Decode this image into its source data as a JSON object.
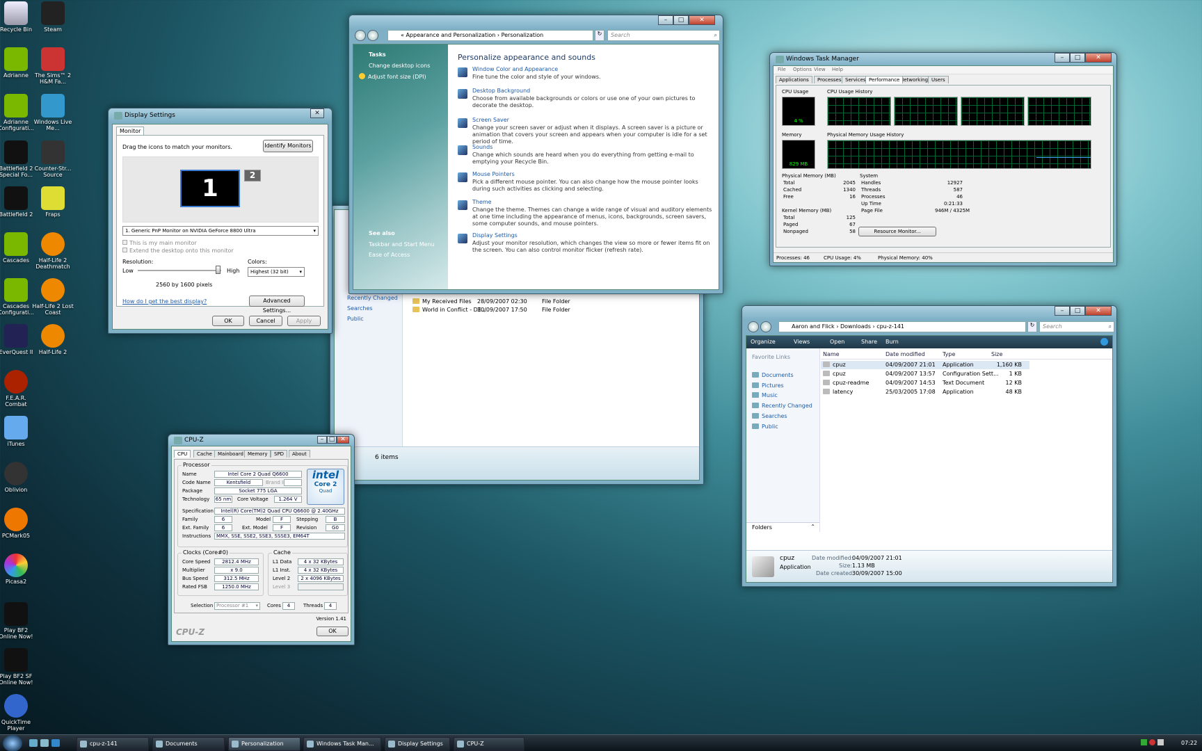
{
  "desktop": {
    "icons": [
      "Recycle Bin",
      "Steam",
      "Adrianne",
      "The Sims™ 2 H&M Fa...",
      "Adrianne Configurati...",
      "Windows Live Me...",
      "Battlefield 2 Special Fo...",
      "Counter-Str... Source",
      "Battlefield 2",
      "Fraps",
      "Cascades",
      "Half-Life 2 Deathmatch",
      "Cascades Configurati...",
      "Half-Life 2 Lost Coast",
      "EverQuest II",
      "Half-Life 2",
      "F.E.A.R. Combat",
      "iTunes",
      "Oblivion",
      "PCMark05",
      "Picasa2",
      "Play BF2 Online Now!",
      "Play BF2 SF Online Now!",
      "QuickTime Player"
    ]
  },
  "display_settings": {
    "title": "Display Settings",
    "tab": "Monitor",
    "instruction": "Drag the icons to match your monitors.",
    "identify_button": "Identify Monitors",
    "monitor1": "1",
    "monitor2": "2",
    "monitor_select": "1. Generic PnP Monitor on NVIDIA GeForce 8800 Ultra",
    "main_monitor": "This is my main monitor",
    "extend": "Extend the desktop onto this monitor",
    "resolution_label": "Resolution:",
    "low": "Low",
    "high": "High",
    "resolution_value": "2560 by 1600 pixels",
    "colors_label": "Colors:",
    "colors_value": "Highest (32 bit)",
    "help_link": "How do I get the best display?",
    "advanced_button": "Advanced Settings...",
    "ok": "OK",
    "cancel": "Cancel",
    "apply": "Apply"
  },
  "personalization": {
    "breadcrumb": [
      "«",
      "Appearance and Personalization",
      "›",
      "Personalization"
    ],
    "search_placeholder": "Search",
    "tasks_title": "Tasks",
    "tasks": [
      "Change desktop icons",
      "Adjust font size (DPI)"
    ],
    "see_also_title": "See also",
    "see_also": [
      "Taskbar and Start Menu",
      "Ease of Access"
    ],
    "heading": "Personalize appearance and sounds",
    "items": [
      {
        "title": "Window Color and Appearance",
        "desc": "Fine tune the color and style of your windows."
      },
      {
        "title": "Desktop Background",
        "desc": "Choose from available backgrounds or colors or use one of your own pictures to decorate the desktop."
      },
      {
        "title": "Screen Saver",
        "desc": "Change your screen saver or adjust when it displays. A screen saver is a picture or animation that covers your screen and appears when your computer is idle for a set period of time."
      },
      {
        "title": "Sounds",
        "desc": "Change which sounds are heard when you do everything from getting e-mail to emptying your Recycle Bin."
      },
      {
        "title": "Mouse Pointers",
        "desc": "Pick a different mouse pointer. You can also change how the mouse pointer looks during such activities as clicking and selecting."
      },
      {
        "title": "Theme",
        "desc": "Change the theme. Themes can change a wide range of visual and auditory elements at one time including the appearance of menus, icons, backgrounds, screen savers, some computer sounds, and mouse pointers."
      },
      {
        "title": "Display Settings",
        "desc": "Adjust your monitor resolution, which changes the view so more or fewer items fit on the screen. You can also control monitor flicker (refresh rate)."
      }
    ]
  },
  "documents": {
    "nav": [
      "Recently Changed",
      "Searches",
      "Public"
    ],
    "files": [
      {
        "name": "My Received Files",
        "date": "28/09/2007 02:30",
        "type": "File Folder"
      },
      {
        "name": "World in Conflict - DE...",
        "date": "30/09/2007 17:50",
        "type": "File Folder"
      }
    ],
    "status": "6 items",
    "fav_partial": "Favo"
  },
  "taskmgr": {
    "title": "Windows Task Manager",
    "menu": [
      "File",
      "Options",
      "View",
      "Help"
    ],
    "tabs": [
      "Applications",
      "Processes",
      "Services",
      "Performance",
      "Networking",
      "Users"
    ],
    "cpu_usage_label": "CPU Usage",
    "cpu_value": "4 %",
    "cpu_history_label": "CPU Usage History",
    "memory_label": "Memory",
    "memory_value": "829 MB",
    "mem_history_label": "Physical Memory Usage History",
    "phys_title": "Physical Memory (MB)",
    "phys": [
      [
        "Total",
        "2045"
      ],
      [
        "Cached",
        "1340"
      ],
      [
        "Free",
        "16"
      ]
    ],
    "kernel_title": "Kernel Memory (MB)",
    "kernel": [
      [
        "Total",
        "125"
      ],
      [
        "Paged",
        "67"
      ],
      [
        "Nonpaged",
        "58"
      ]
    ],
    "system_title": "System",
    "system": [
      [
        "Handles",
        "12927"
      ],
      [
        "Threads",
        "587"
      ],
      [
        "Processes",
        "46"
      ],
      [
        "Up Time",
        "0:21:33"
      ],
      [
        "Page File",
        "946M / 4325M"
      ]
    ],
    "resource_button": "Resource Monitor...",
    "status": [
      "Processes: 46",
      "CPU Usage: 4%",
      "Physical Memory: 40%"
    ]
  },
  "explorer": {
    "breadcrumb": [
      "Aaron and Flick",
      "›",
      "Downloads",
      "›",
      "cpu-z-141"
    ],
    "search_placeholder": "Search",
    "toolbar": [
      "Organize",
      "Views",
      "Open",
      "Share",
      "Burn"
    ],
    "fav_title": "Favorite Links",
    "links": [
      "Documents",
      "Pictures",
      "Music",
      "Recently Changed",
      "Searches",
      "Public"
    ],
    "folders": "Folders",
    "columns": [
      "Name",
      "Date modified",
      "Type",
      "Size"
    ],
    "files": [
      {
        "name": "cpuz",
        "date": "04/09/2007 21:01",
        "type": "Application",
        "size": "1,160 KB"
      },
      {
        "name": "cpuz",
        "date": "04/09/2007 13:57",
        "type": "Configuration Sett...",
        "size": "1 KB"
      },
      {
        "name": "cpuz-readme",
        "date": "04/09/2007 14:53",
        "type": "Text Document",
        "size": "12 KB"
      },
      {
        "name": "latency",
        "date": "25/03/2005 17:08",
        "type": "Application",
        "size": "48 KB"
      }
    ],
    "detail": {
      "name": "cpuz",
      "type": "Application",
      "modified_label": "Date modified:",
      "modified": "04/09/2007 21:01",
      "size_label": "Size:",
      "size": "1.13 MB",
      "created_label": "Date created:",
      "created": "30/09/2007 15:00"
    }
  },
  "cpuz": {
    "title": "CPU-Z",
    "tabs": [
      "CPU",
      "Cache",
      "Mainboard",
      "Memory",
      "SPD",
      "About"
    ],
    "processor_group": "Processor",
    "name_l": "Name",
    "name": "Intel Core 2 Quad Q6600",
    "codename_l": "Code Name",
    "codename": "Kentsfield",
    "brandid": "Brand ID",
    "package_l": "Package",
    "package": "Socket 775 LGA",
    "tech_l": "Technology",
    "tech": "65 nm",
    "cv_l": "Core Voltage",
    "cv": "1.264 V",
    "spec_l": "Specification",
    "spec": "Intel(R) Core(TM)2 Quad CPU   Q6600  @ 2.40GHz",
    "family_l": "Family",
    "family": "6",
    "model_l": "Model",
    "model": "F",
    "stepping_l": "Stepping",
    "stepping": "B",
    "extfam_l": "Ext. Family",
    "extfam": "6",
    "extmodel_l": "Ext. Model",
    "extmodel": "F",
    "revision_l": "Revision",
    "revision": "G0",
    "instr_l": "Instructions",
    "instr": "MMX, SSE, SSE2, SSE3, SSSE3, EM64T",
    "clocks_group": "Clocks (Core#0)",
    "cs_l": "Core Speed",
    "cs": "2812.4 MHz",
    "mult_l": "Multiplier",
    "mult": "x 9.0",
    "bus_l": "Bus Speed",
    "bus": "312.5 MHz",
    "fsb_l": "Rated FSB",
    "fsb": "1250.0 MHz",
    "cache_group": "Cache",
    "l1d_l": "L1 Data",
    "l1d": "4 x 32 KBytes",
    "l1i_l": "L1 Inst.",
    "l1i": "4 x 32 KBytes",
    "l2_l": "Level 2",
    "l2": "2 x 4096 KBytes",
    "l3_l": "Level 3",
    "sel_l": "Selection",
    "sel": "Processor #1",
    "cores_l": "Cores",
    "cores": "4",
    "threads_l": "Threads",
    "threads": "4",
    "version": "Version 1.41",
    "brand": "CPU-Z",
    "ok": "OK",
    "intel": "intel",
    "core2": "Core 2",
    "quad": "Quad"
  },
  "taskbar": {
    "buttons": [
      "cpu-z-141",
      "Documents",
      "Personalization",
      "Windows Task Man...",
      "Display Settings",
      "CPU-Z"
    ],
    "clock": "07:22"
  }
}
